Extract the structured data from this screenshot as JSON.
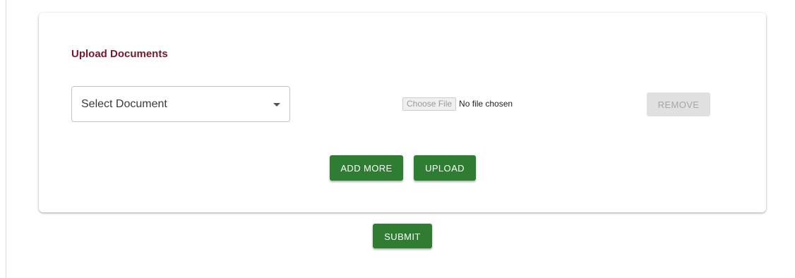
{
  "upload_section": {
    "title": "Upload Documents",
    "document_select": {
      "selected": "Select Document"
    },
    "file_input": {
      "button_label": "Choose File",
      "status": "No file chosen"
    },
    "remove_label": "REMOVE",
    "add_more_label": "ADD MORE",
    "upload_label": "UPLOAD"
  },
  "submit_label": "SUBMIT",
  "colors": {
    "title": "#7a1530",
    "primary_button": "#2e7d32",
    "disabled_button": "#e0e0e0"
  },
  "icons": {
    "select_caret": "caret-down-icon"
  }
}
